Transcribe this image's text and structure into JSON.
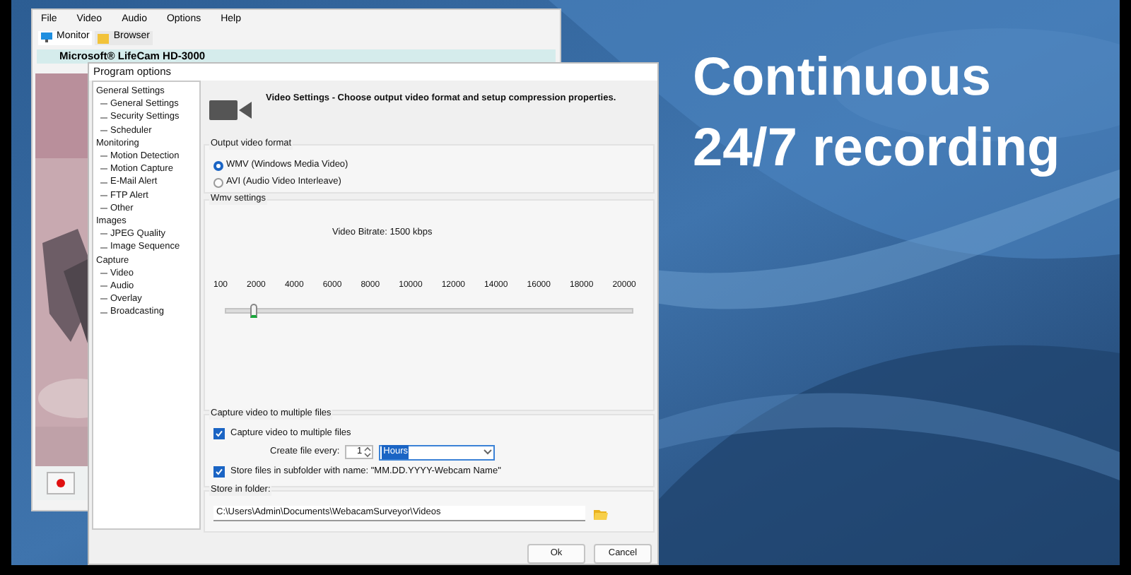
{
  "headline": [
    "Continuous",
    "24/7 recording"
  ],
  "main_window": {
    "menu": [
      "File",
      "Video",
      "Audio",
      "Options",
      "Help"
    ],
    "tabs": [
      {
        "label": "Monitor",
        "selected": true
      },
      {
        "label": "Browser",
        "selected": false
      }
    ],
    "camera_title": "Microsoft® LifeCam HD-3000"
  },
  "dialog": {
    "title": "Program options",
    "tree": [
      {
        "label": "General Settings",
        "children": [
          {
            "label": "General Settings"
          },
          {
            "label": "Security Settings"
          },
          {
            "label": "Scheduler"
          }
        ]
      },
      {
        "label": "Monitoring",
        "children": [
          {
            "label": "Motion Detection"
          },
          {
            "label": "Motion Capture"
          },
          {
            "label": "E-Mail Alert"
          },
          {
            "label": "FTP Alert"
          },
          {
            "label": "Other"
          }
        ]
      },
      {
        "label": "Images",
        "children": [
          {
            "label": "JPEG Quality"
          },
          {
            "label": "Image Sequence"
          }
        ]
      },
      {
        "label": "Capture",
        "children": [
          {
            "label": "Video"
          },
          {
            "label": "Audio"
          },
          {
            "label": "Overlay"
          },
          {
            "label": "Broadcasting"
          }
        ]
      }
    ],
    "header": "Video Settings - Choose output video format and setup compression properties.",
    "output_format": {
      "title": "Output video format",
      "options": [
        {
          "label": "WMV (Windows Media Video)",
          "selected": true
        },
        {
          "label": "AVI (Audio Video Interleave)",
          "selected": false
        }
      ]
    },
    "wmv_settings": {
      "title": "Wmv settings",
      "bitrate": "Video Bitrate:  1500 kbps",
      "ticks": [
        "100",
        "2000",
        "4000",
        "6000",
        "8000",
        "10000",
        "12000",
        "14000",
        "16000",
        "18000",
        "20000"
      ],
      "level": 0.07
    },
    "multiple_files": {
      "title": "Capture video to multiple files",
      "capture_checkbox": {
        "label": "Capture video to multiple files",
        "checked": true
      },
      "create_every_label": "Create file every:",
      "count": "1",
      "unit": "Hours",
      "subfolder_checkbox": {
        "label": "Store files in subfolder with name: \"MM.DD.YYYY-Webcam Name\"",
        "checked": true
      }
    },
    "store_folder": {
      "title": "Store in folder:",
      "path": "C:\\Users\\Admin\\Documents\\WebacamSurveyor\\Videos"
    },
    "buttons": [
      "Ok",
      "Cancel"
    ]
  }
}
